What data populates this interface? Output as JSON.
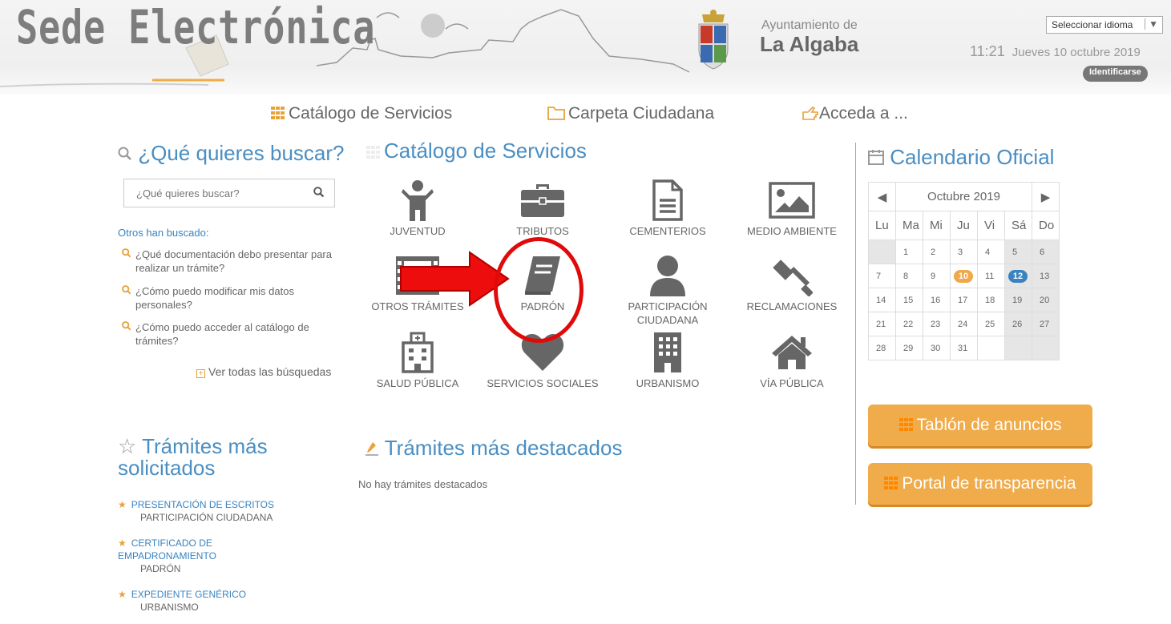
{
  "header": {
    "site_title": "Sede Electrónica",
    "ayuntamiento_small": "Ayuntamiento de",
    "ayuntamiento_name": "La Algaba",
    "language_select": "Seleccionar idioma",
    "time": "11:21",
    "date": "Jueves 10 octubre 2019",
    "login_label": "Identificarse"
  },
  "topnav": {
    "catalog": "Catálogo de Servicios",
    "folder": "Carpeta Ciudadana",
    "access": "Acceda a ..."
  },
  "search": {
    "heading": "¿Qué quieres buscar?",
    "placeholder": "¿Qué quieres buscar?",
    "others_label": "Otros han buscado:",
    "items": [
      "¿Qué documentación debo presentar para realizar un trámite?",
      "¿Cómo puedo modificar mis datos personales?",
      "¿Cómo puedo acceder al catálogo de trámites?"
    ],
    "see_all": "Ver todas las búsquedas"
  },
  "catalog": {
    "heading": "Catálogo de Servicios",
    "items": [
      {
        "label": "JUVENTUD",
        "icon": "child-icon"
      },
      {
        "label": "TRIBUTOS",
        "icon": "briefcase-icon"
      },
      {
        "label": "CEMENTERIOS",
        "icon": "document-icon"
      },
      {
        "label": "MEDIO AMBIENTE",
        "icon": "image-icon"
      },
      {
        "label": "OTROS TRÁMITES",
        "icon": "film-icon"
      },
      {
        "label": "PADRÓN",
        "icon": "book-icon"
      },
      {
        "label": "PARTICIPACIÓN CIUDADANA",
        "icon": "user-icon"
      },
      {
        "label": "RECLAMACIONES",
        "icon": "gavel-icon"
      },
      {
        "label": "SALUD PÚBLICA",
        "icon": "hospital-icon"
      },
      {
        "label": "SERVICIOS SOCIALES",
        "icon": "heart-icon"
      },
      {
        "label": "URBANISMO",
        "icon": "building-icon"
      },
      {
        "label": "VÍA PÚBLICA",
        "icon": "home-icon"
      }
    ]
  },
  "calendar": {
    "heading": "Calendario Oficial",
    "month": "Octubre 2019",
    "weekdays": [
      "Lu",
      "Ma",
      "Mi",
      "Ju",
      "Vi",
      "Sá",
      "Do"
    ],
    "weeks": [
      [
        "",
        "1",
        "2",
        "3",
        "4",
        "5",
        "6"
      ],
      [
        "7",
        "8",
        "9",
        "10",
        "11",
        "12",
        "13"
      ],
      [
        "14",
        "15",
        "16",
        "17",
        "18",
        "19",
        "20"
      ],
      [
        "21",
        "22",
        "23",
        "24",
        "25",
        "26",
        "27"
      ],
      [
        "28",
        "29",
        "30",
        "31",
        "",
        "",
        ""
      ]
    ],
    "today_color": "#f0a84a",
    "holiday_color": "#3a83c0"
  },
  "buttons": {
    "tablon": "Tablón de anuncios",
    "transparencia": "Portal de transparencia"
  },
  "most_requested": {
    "heading_line1": "Trámites más",
    "heading_line2": "solicitados",
    "items": [
      {
        "title": "PRESENTACIÓN DE ESCRITOS",
        "category": "PARTICIPACIÓN CIUDADANA"
      },
      {
        "title_line1": "CERTIFICADO DE",
        "title_line2": "EMPADRONAMIENTO",
        "category": "PADRÓN"
      },
      {
        "title": "EXPEDIENTE GENÉRICO",
        "category": "URBANISMO"
      }
    ]
  },
  "featured": {
    "heading": "Trámites más destacados",
    "empty": "No hay trámites destacados"
  },
  "colors": {
    "accent_blue": "#4a8ec2",
    "accent_orange": "#f0ab4a",
    "annotation_red": "#e10a0a"
  }
}
